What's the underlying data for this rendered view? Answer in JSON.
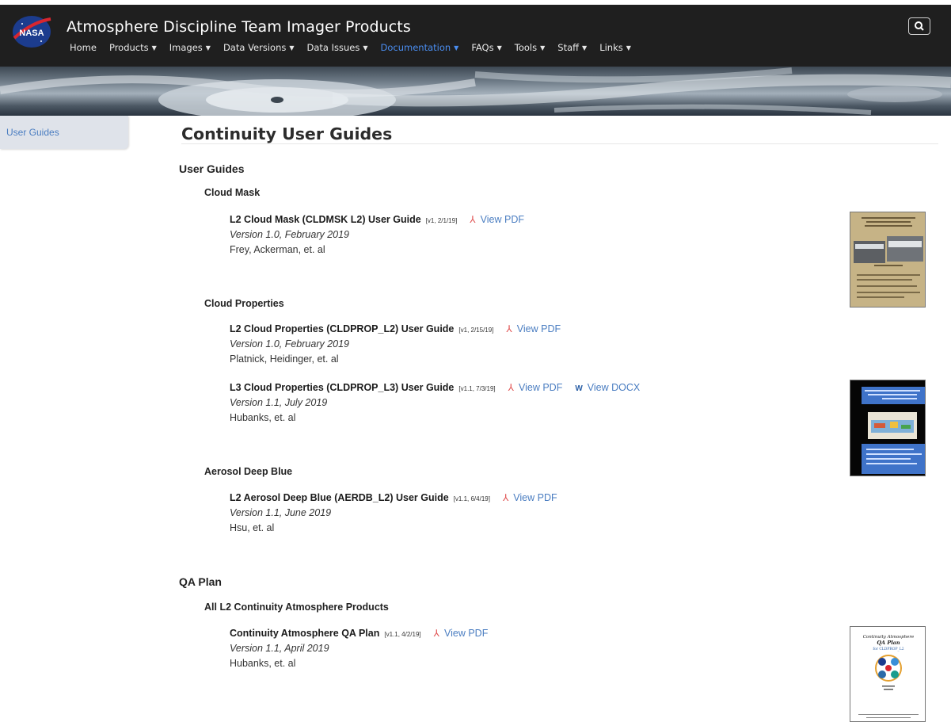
{
  "header": {
    "logo_text": "NASA",
    "title": "Atmosphere Discipline Team Imager Products",
    "nav": [
      {
        "label": "Home",
        "dropdown": false,
        "active": false
      },
      {
        "label": "Products",
        "dropdown": true,
        "active": false
      },
      {
        "label": "Images",
        "dropdown": true,
        "active": false
      },
      {
        "label": "Data Versions",
        "dropdown": true,
        "active": false
      },
      {
        "label": "Data Issues",
        "dropdown": true,
        "active": false
      },
      {
        "label": "Documentation",
        "dropdown": true,
        "active": true
      },
      {
        "label": "FAQs",
        "dropdown": true,
        "active": false
      },
      {
        "label": "Tools",
        "dropdown": true,
        "active": false
      },
      {
        "label": "Staff",
        "dropdown": true,
        "active": false
      },
      {
        "label": "Links",
        "dropdown": true,
        "active": false
      }
    ],
    "search_icon": "search-icon"
  },
  "sidebar": {
    "items": [
      {
        "label": "User Guides"
      }
    ]
  },
  "page": {
    "title": "Continuity User Guides",
    "sections": [
      {
        "heading": "User Guides"
      },
      {
        "heading": "QA Plan"
      }
    ],
    "categories": [
      {
        "heading": "Cloud Mask"
      },
      {
        "heading": "Cloud Properties"
      },
      {
        "heading": "Aerosol Deep Blue"
      },
      {
        "heading": "All L2 Continuity Atmosphere Products"
      }
    ],
    "docs": [
      {
        "title": "L2 Cloud Mask (CLDMSK L2) User Guide",
        "version_tag": "[v1, 2/1/19]",
        "pdf_label": "View PDF",
        "version": "Version 1.0, February 2019",
        "authors": "Frey, Ackerman, et. al"
      },
      {
        "title": "L2 Cloud Properties (CLDPROP_L2) User Guide",
        "version_tag": "[v1, 2/15/19]",
        "pdf_label": "View PDF",
        "version": "Version 1.0, February 2019",
        "authors": "Platnick, Heidinger, et. al"
      },
      {
        "title": "L3 Cloud Properties (CLDPROP_L3) User Guide",
        "version_tag": "[v1.1, 7/3/19]",
        "pdf_label": "View PDF",
        "docx_label": "View DOCX",
        "version": "Version 1.1, July 2019",
        "authors": "Hubanks, et. al"
      },
      {
        "title": "L2 Aerosol Deep Blue (AERDB_L2) User Guide",
        "version_tag": "[v1.1, 6/4/19]",
        "pdf_label": "View PDF",
        "version": "Version 1.1, June 2019",
        "authors": "Hsu, et. al"
      },
      {
        "title": "Continuity Atmosphere QA Plan",
        "version_tag": "[v1.1, 4/2/19]",
        "pdf_label": "View PDF",
        "version": "Version 1.1, April 2019",
        "authors": "Hubanks, et. al"
      }
    ],
    "thumbnails": {
      "qa_plan_cover_title": "Continuity Atmosphere",
      "qa_plan_cover_subtitle": "QA Plan",
      "qa_plan_cover_product": "for CLDPROP_L2"
    }
  },
  "colors": {
    "accent": "#4a8df0",
    "link": "#4a7dc1",
    "header_bg": "#1f1f1f",
    "pdf_icon": "#e05050"
  }
}
